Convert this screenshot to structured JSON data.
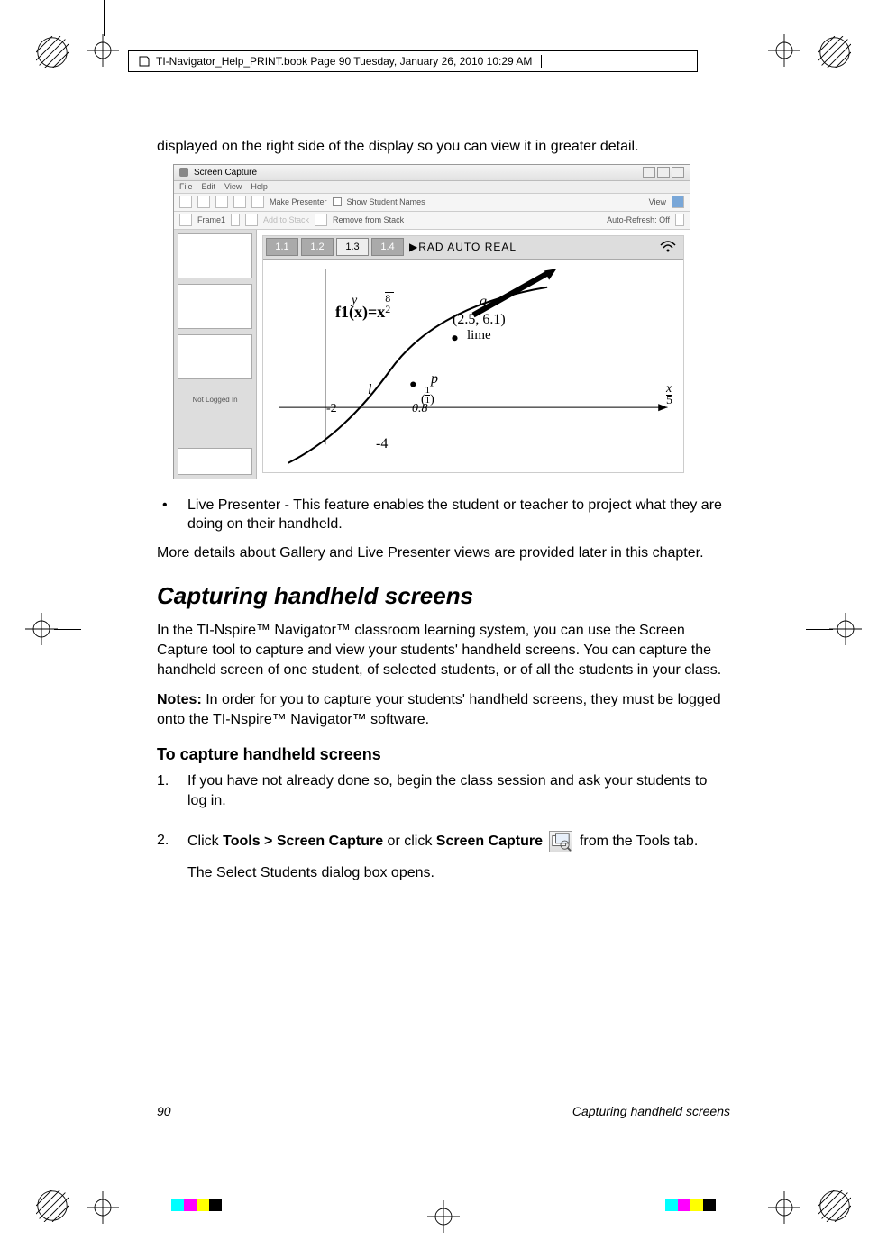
{
  "running_head": "TI-Navigator_Help_PRINT.book  Page 90  Tuesday, January 26, 2010  10:29 AM",
  "intro_para": "displayed on the right side of the display so you can view it in greater detail.",
  "bullet1": "Live Presenter - This feature enables the student or teacher to project what they are doing on their handheld.",
  "after_bullets": "More details about Gallery and Live Presenter views are provided later in this chapter.",
  "section_title": "Capturing handheld screens",
  "section_p1": "In the TI-Nspire™ Navigator™ classroom learning system, you can use the Screen Capture tool to capture and view your students' handheld screens. You can capture the handheld screen of one student, of selected students, or of all the students in your class.",
  "section_notes_label": "Notes:",
  "section_notes_text": " In order for you to capture your students' handheld screens, they must be logged onto the TI-Nspire™ Navigator™ software.",
  "subsection_title": "To capture handheld screens",
  "step1": "If you have not already done so, begin the class session and ask your students to log in.",
  "step2_pre": "Click ",
  "step2_menu": "Tools > Screen Capture",
  "step2_mid": " or click ",
  "step2_btn": "Screen Capture",
  "step2_post": " from the Tools tab.",
  "step2_sub": "The Select Students dialog box opens.",
  "footer_page": "90",
  "footer_chapter": "Capturing handheld screens",
  "screenshot": {
    "title": "Screen Capture",
    "menu": [
      "File",
      "Edit",
      "View",
      "Help"
    ],
    "toolbar": {
      "make_presenter": "Make Presenter",
      "show_names": "Show Student Names",
      "view_label": "View"
    },
    "toolbar2": {
      "frame_label": "Frame1",
      "add_to_stack": "Add to Stack",
      "remove_from_stack": "Remove from Stack",
      "auto_refresh": "Auto-Refresh: Off"
    },
    "not_logged": "Not Logged In",
    "calc": {
      "tabs": [
        "1.1",
        "1.2",
        "1.3",
        "1.4"
      ],
      "status": "▶RAD AUTO REAL",
      "func_label": "f1(x)=x",
      "exp1_num": "8",
      "exp1_den": "2",
      "y": "y",
      "q": "q",
      "point_text": "(2.5, 6.1)",
      "lime": "lime",
      "p": "p",
      "ratio_text": "1/1",
      "l": "l",
      "neg2": "-2",
      "val08": "0.8",
      "neg4": "-4",
      "x": "x",
      "frac5": "5"
    }
  }
}
